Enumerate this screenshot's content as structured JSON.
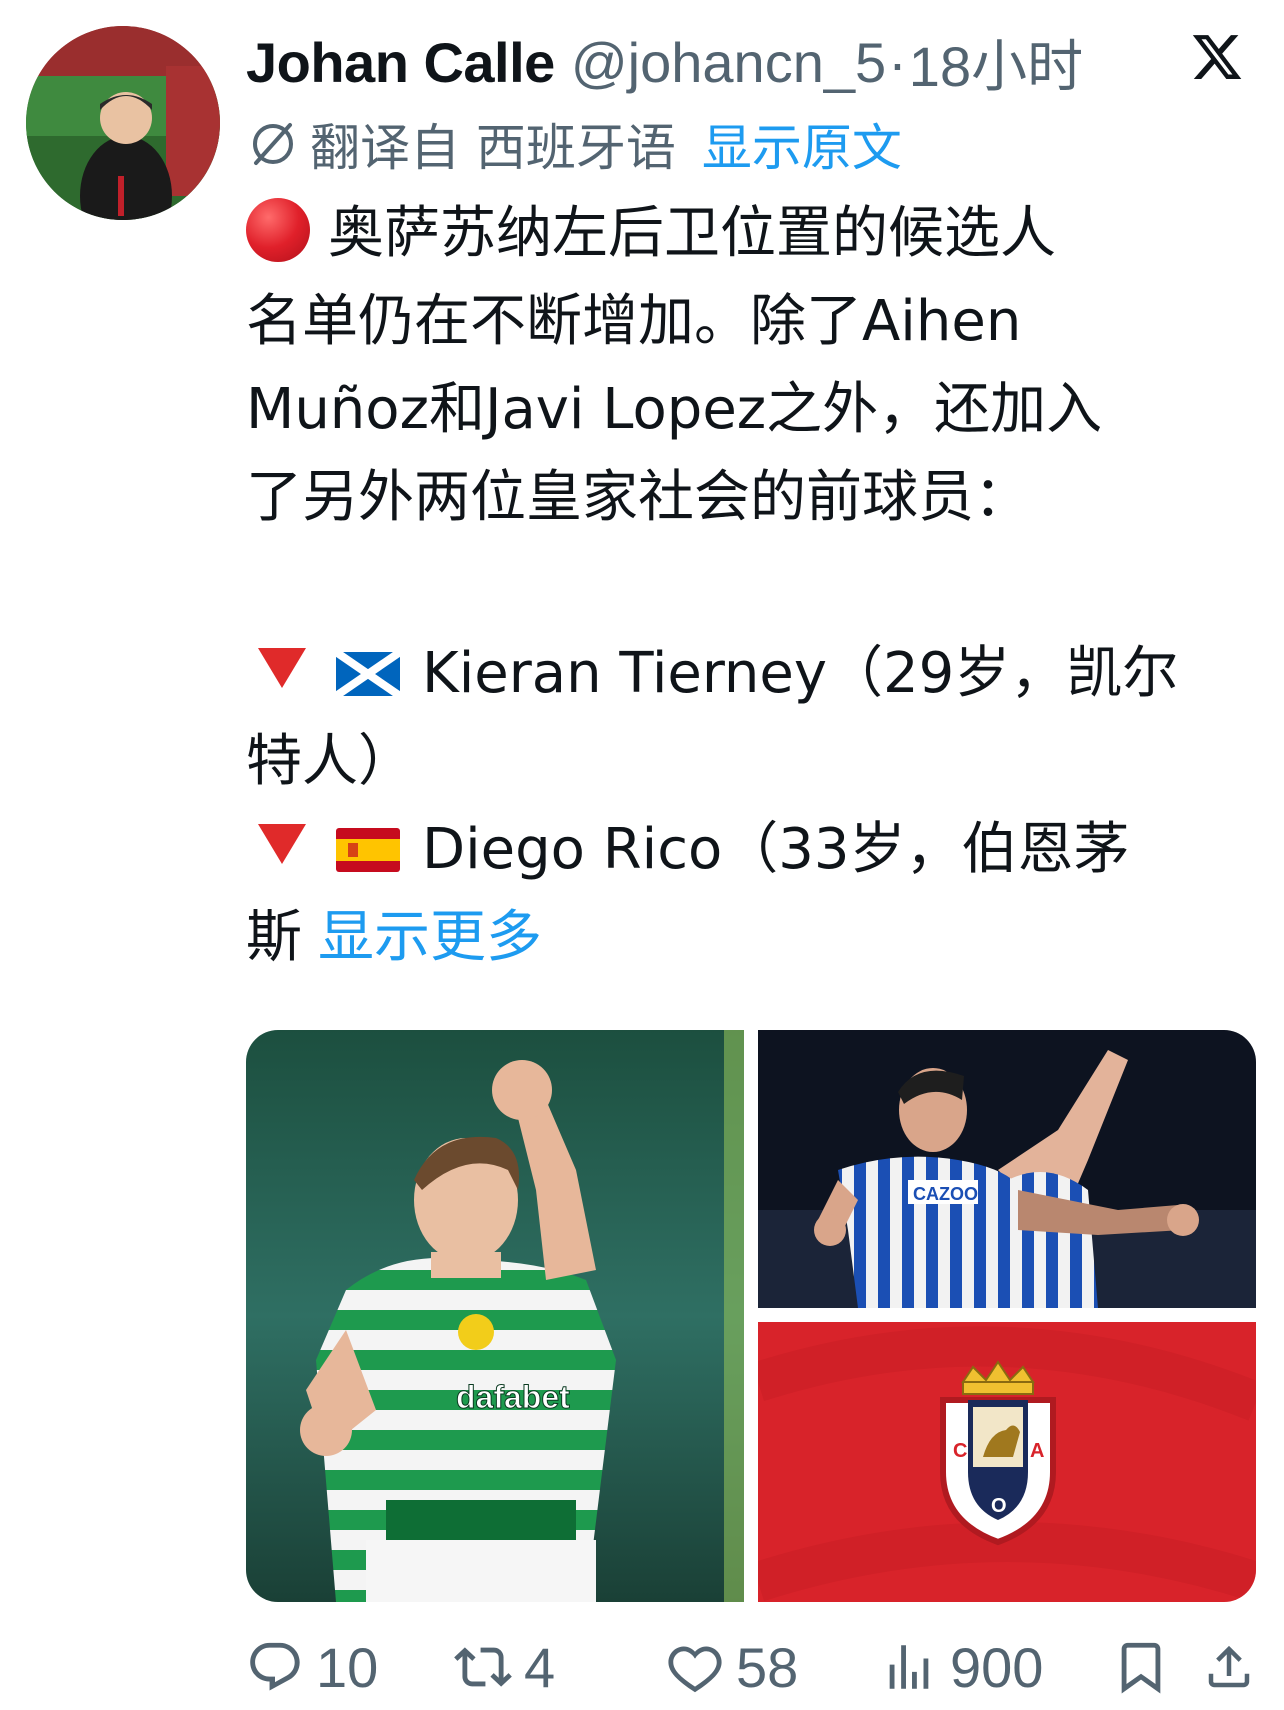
{
  "author": {
    "name": "Johan Calle",
    "handle": "@johancn_5",
    "separator": "·",
    "time": "18小时"
  },
  "translation": {
    "label": "翻译自 西班牙语",
    "show_original": "显示原文"
  },
  "tweet": {
    "lines": [
      "奥萨苏纳左后卫位置的候选人",
      "名单仍在不断增加。除了Aihen",
      "Muñoz和Javi Lopez之外，还加入",
      "了另外两位皇家社会的前球员："
    ],
    "item1_line1": "Kieran Tierney（29岁，凯尔",
    "item1_line2": "特人）",
    "item2_line1": "Diego Rico（33岁，伯恩茅",
    "item2_line2": "斯",
    "show_more": "显示更多"
  },
  "media": {
    "left_image": "Kieran Tierney celebrating in Celtic kit",
    "left_shirt_text": "dafabet",
    "top_right_image": "Diego Rico celebrating in Real Sociedad kit",
    "top_right_shirt_text": "CAZOO",
    "bottom_right_image": "CA Osasuna crest on red background",
    "crest_letters": [
      "C",
      "A",
      "O"
    ]
  },
  "actions": {
    "replies": "10",
    "retweets": "4",
    "likes": "58",
    "views": "900"
  },
  "colors": {
    "text_primary": "#0f1419",
    "text_secondary": "#536471",
    "link": "#1d9bf0",
    "osasuna_red": "#d8232a"
  },
  "icons": [
    "x-logo-icon",
    "translate-icon",
    "red-circle-icon",
    "red-triangle-icon",
    "scotland-flag-icon",
    "spain-flag-icon",
    "reply-icon",
    "retweet-icon",
    "like-icon",
    "views-icon",
    "bookmark-icon",
    "share-icon"
  ]
}
